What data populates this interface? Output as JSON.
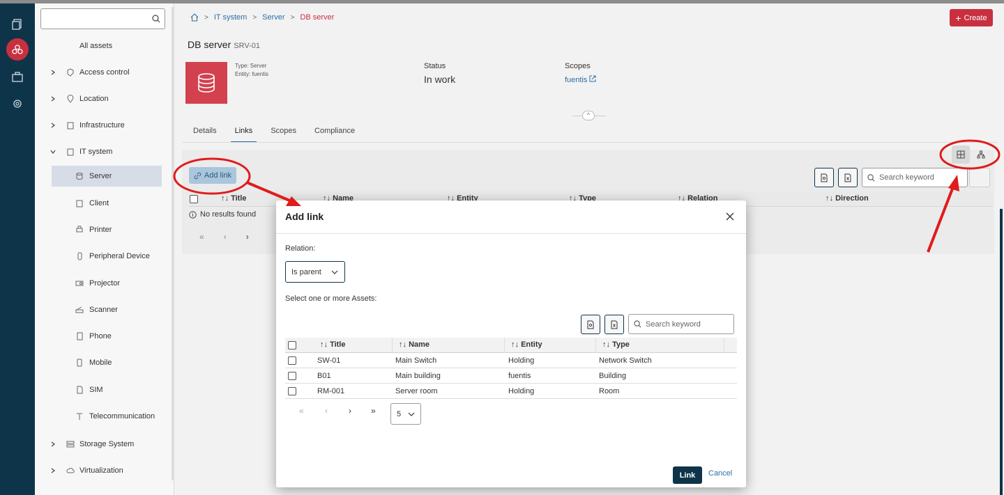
{
  "sidebar": {
    "all_assets": "All assets",
    "items": [
      {
        "label": "Access control"
      },
      {
        "label": "Location"
      },
      {
        "label": "Infrastructure"
      },
      {
        "label": "IT system"
      },
      {
        "label": "Server"
      },
      {
        "label": "Client"
      },
      {
        "label": "Printer"
      },
      {
        "label": "Peripheral Device"
      },
      {
        "label": "Projector"
      },
      {
        "label": "Scanner"
      },
      {
        "label": "Phone"
      },
      {
        "label": "Mobile"
      },
      {
        "label": "SIM"
      },
      {
        "label": "Telecommunication"
      },
      {
        "label": "Storage System"
      },
      {
        "label": "Virtualization"
      }
    ]
  },
  "breadcrumb": [
    "IT system",
    "Server",
    "DB server"
  ],
  "header": {
    "create_label": "Create"
  },
  "asset": {
    "title": "DB server",
    "code": "SRV-01",
    "type_line": "Type: Server",
    "entity_line": "Entity: fuentis",
    "status_label": "Status",
    "status_value": "In work",
    "scopes_label": "Scopes",
    "scopes_value": "fuentis"
  },
  "tabs": [
    "Details",
    "Links",
    "Scopes",
    "Compliance"
  ],
  "links_panel": {
    "add_link_label": "Add link",
    "search_placeholder": "Search keyword",
    "columns": [
      "Title",
      "Name",
      "Entity",
      "Type",
      "Relation",
      "Direction"
    ],
    "no_results": "No results found"
  },
  "modal": {
    "title": "Add link",
    "relation_label": "Relation:",
    "relation_value": "Is parent",
    "select_label": "Select one or more Assets:",
    "search_placeholder": "Search keyword",
    "columns": [
      "Title",
      "Name",
      "Entity",
      "Type"
    ],
    "rows": [
      {
        "title": "SW-01",
        "name": "Main Switch",
        "entity": "Holding",
        "type": "Network Switch"
      },
      {
        "title": "B01",
        "name": "Main building",
        "entity": "fuentis",
        "type": "Building"
      },
      {
        "title": "RM-001",
        "name": "Server room",
        "entity": "Holding",
        "type": "Room"
      }
    ],
    "page_size": "5",
    "link_label": "Link",
    "cancel_label": "Cancel"
  },
  "colors": {
    "brand_red": "#c8303f",
    "navy": "#0e3449",
    "link_blue": "#2d6ea3",
    "annotation_red": "#e01b1b"
  }
}
